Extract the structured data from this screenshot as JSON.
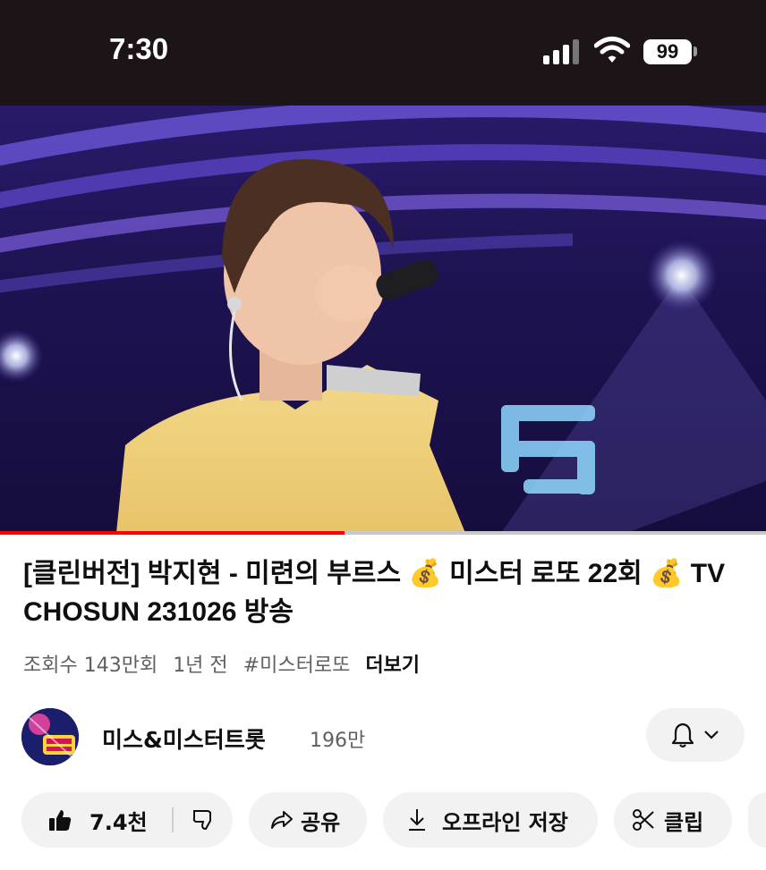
{
  "status_bar": {
    "time": "7:30",
    "battery": "99"
  },
  "video": {
    "progress": 0.45
  },
  "title": "[클린버전]  박지현 - 미련의 부르스 💰 미스터 로또 22회 💰 TV CHOSUN 231026 방송",
  "meta": {
    "views": "조회수 143만회",
    "age": "1년 전",
    "hashtag": "#미스터로또",
    "more": "더보기"
  },
  "channel": {
    "name": "미스&미스터트롯",
    "subscribers": "196만"
  },
  "actions": {
    "like_count": "7.4천",
    "share": "공유",
    "offline_save": "오프라인 저장",
    "clip": "클립"
  },
  "colors": {
    "progress": "#ff0000",
    "pill_bg": "#f2f2f2",
    "status_bg": "#1c1416"
  },
  "icons": [
    "signal-icon",
    "wifi-icon",
    "battery-icon",
    "bell-icon",
    "chevron-down-icon",
    "thumbs-up-icon",
    "thumbs-down-icon",
    "share-icon",
    "download-icon",
    "scissors-icon"
  ]
}
